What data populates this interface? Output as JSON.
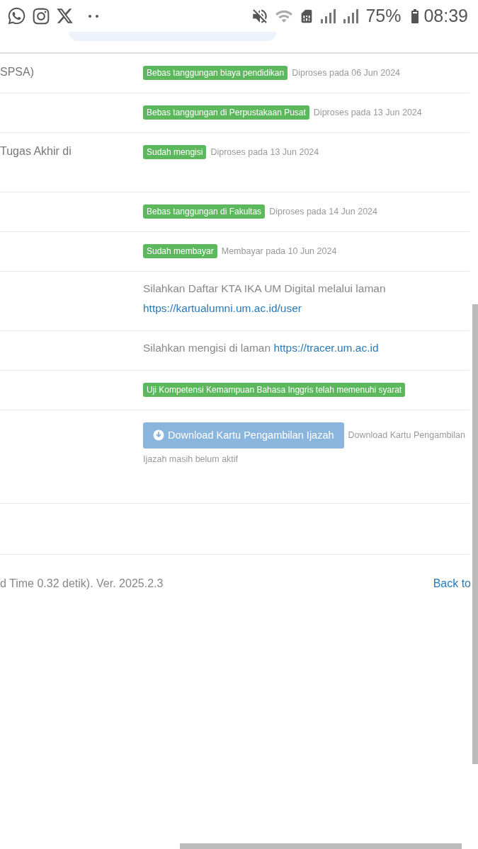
{
  "status_bar": {
    "battery": "75%",
    "time": "08:39"
  },
  "rows": [
    {
      "label": "SPSA)",
      "kind": "badge",
      "badge": "Bebas tanggungan biaya pendidikan",
      "note": "Diproses pada 06 Jun 2024"
    },
    {
      "kind": "badge",
      "badge": "Bebas tanggungan di Perpustakaan Pusat",
      "note": "Diproses pada 13 Jun 2024"
    },
    {
      "label": "Tugas Akhir di",
      "kind": "badge",
      "badge": "Sudah mengisi",
      "note": "Diproses pada 13 Jun 2024",
      "tall": true
    },
    {
      "kind": "badge",
      "badge": "Bebas tanggungan di Fakultas",
      "note": "Diproses pada 14 Jun 2024"
    },
    {
      "kind": "badge",
      "badge": "Sudah membayar",
      "note": "Membayar pada 10 Jun 2024"
    },
    {
      "kind": "link_text",
      "text": "Silahkan Daftar KTA IKA UM Digital melalui laman",
      "link": "https://kartualumni.um.ac.id/user",
      "link_on_new_line": true
    },
    {
      "kind": "link_text",
      "text": "Silahkan mengisi di laman",
      "link": "https://tracer.um.ac.id",
      "link_on_new_line": false
    },
    {
      "kind": "badge",
      "badge": "Uji Kompetensi Kemampuan Bahasa Inggris telah memenuhi syarat"
    },
    {
      "kind": "download",
      "button": "Download Kartu Pengambilan Ijazah",
      "disabled": true,
      "note": "Download Kartu Pengambilan",
      "note_continued": "Ijazah masih belum aktif"
    },
    {
      "kind": "empty"
    }
  ],
  "footer": {
    "text": "d Time 0.32 detik). Ver. 2025.2.3",
    "link": "Back to"
  }
}
